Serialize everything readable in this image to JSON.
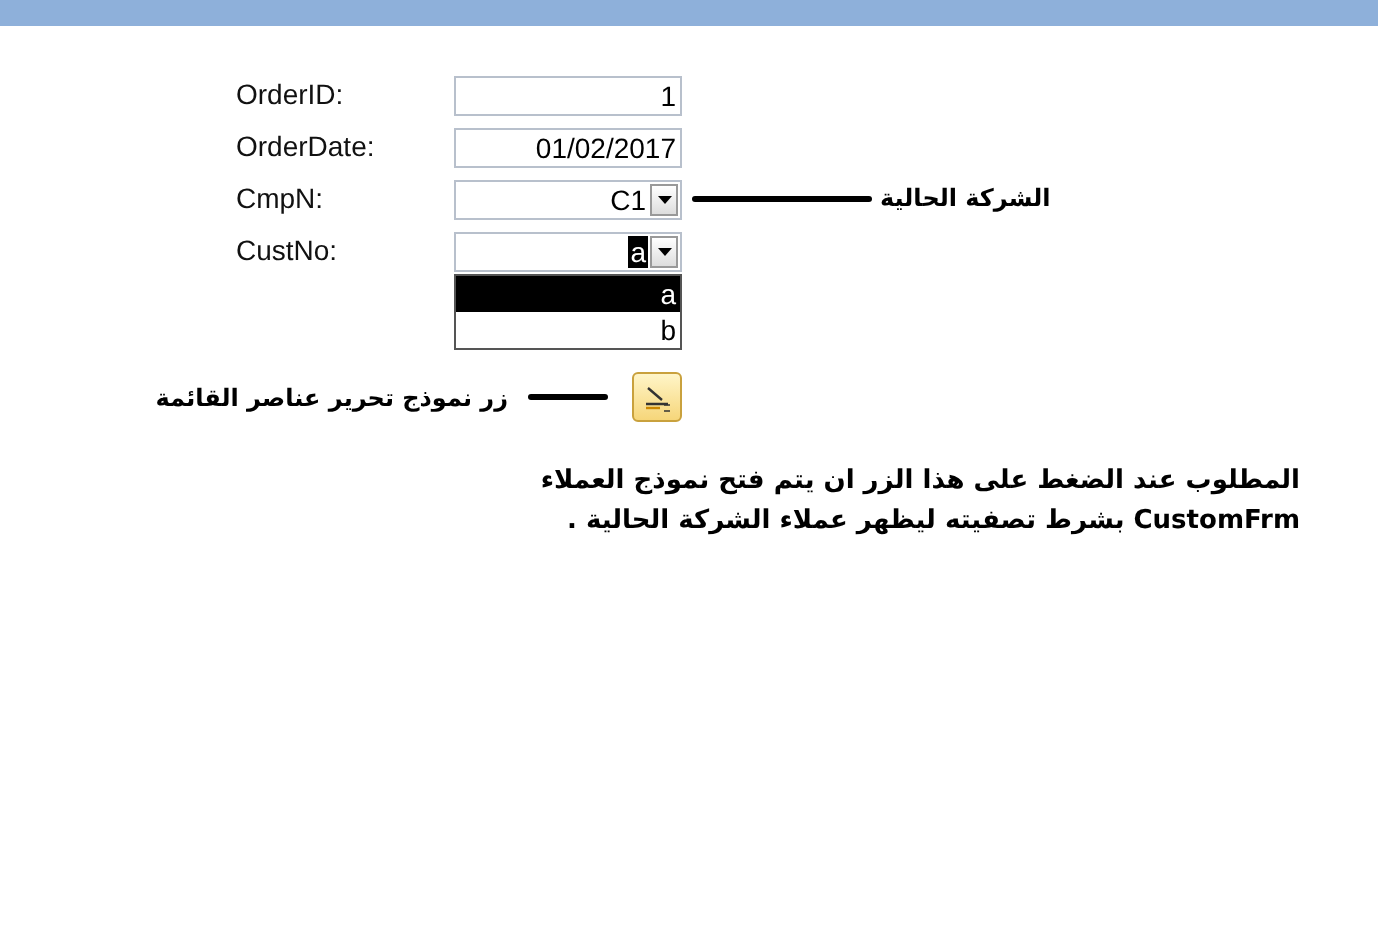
{
  "fields": [
    {
      "label": "OrderID:",
      "kind": "text",
      "value": "1"
    },
    {
      "label": "OrderDate:",
      "kind": "text",
      "value": "01/02/2017"
    },
    {
      "label": "CmpN:",
      "kind": "combo",
      "value": "C1",
      "note": "الشركة الحالية"
    },
    {
      "label": "CustNo:",
      "kind": "combo",
      "value": "a",
      "expanded": true,
      "options": [
        {
          "label": "a",
          "selected": true
        },
        {
          "label": "b",
          "selected": false
        }
      ]
    }
  ],
  "edit_button": {
    "note": "زر نموذج تحرير عناصر القائمة"
  },
  "description": {
    "lines": [
      "المطلوب عند الضغط على هذا الزر ان يتم فتح نموذج العملاء",
      "CustomFrm  بشرط تصفيته ليظهر عملاء الشركة الحالية ."
    ]
  }
}
